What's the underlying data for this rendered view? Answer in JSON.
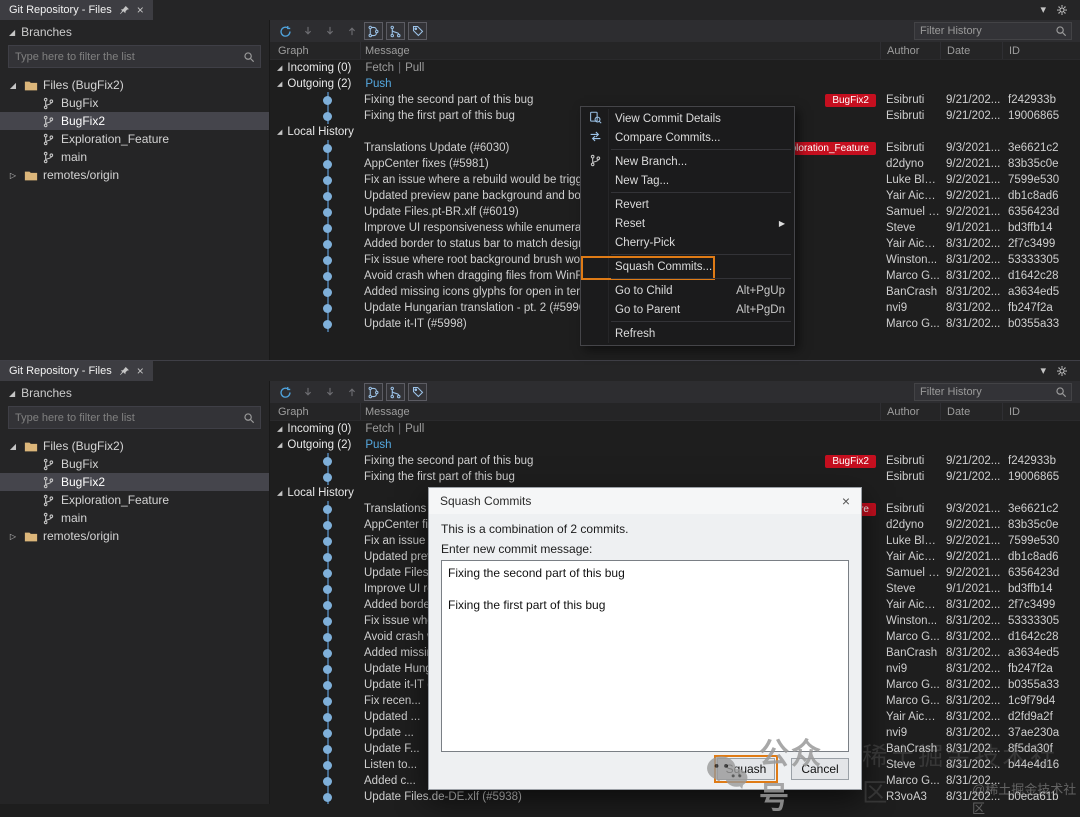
{
  "window": {
    "tab_title": "Git Repository - Files"
  },
  "colors": {
    "annotation_orange": "#df7b16",
    "tag_red": "#c50f1f",
    "link_blue": "#55a9e0",
    "graph_dot_blue": "#7fb0da",
    "selection_gray": "#45454c"
  },
  "sidebar": {
    "header": "Branches",
    "filter_placeholder": "Type here to filter the list",
    "tree": [
      {
        "label": "Files (BugFix2)",
        "level": 0,
        "icon": "folder",
        "expander": "expanded"
      },
      {
        "label": "BugFix",
        "level": 1,
        "icon": "branch"
      },
      {
        "label": "BugFix2",
        "level": 1,
        "icon": "branch",
        "selected": true
      },
      {
        "label": "Exploration_Feature",
        "level": 1,
        "icon": "branch"
      },
      {
        "label": "main",
        "level": 1,
        "icon": "branch"
      },
      {
        "label": "remotes/origin",
        "level": 0,
        "icon": "folder",
        "expander": "collapsed"
      }
    ]
  },
  "history": {
    "toolbar_icons": [
      "refresh",
      "fetch",
      "pull",
      "push",
      "show-graph",
      "show-merges",
      "show-tags"
    ],
    "filter_placeholder": "Filter History",
    "columns": [
      "Graph",
      "Message",
      "Author",
      "Date",
      "ID"
    ]
  },
  "rows_top": [
    {
      "type": "section",
      "label": "Incoming (0)",
      "links": [
        "Fetch",
        "Pull"
      ],
      "links_disabled": true
    },
    {
      "type": "section",
      "label": "Outgoing (2)",
      "links": [
        "Push"
      ],
      "links_disabled": false
    },
    {
      "type": "commit",
      "message": "Fixing the second part of this bug",
      "tag": "BugFix2",
      "author": "Esibruti",
      "date": "9/21/202...",
      "id": "f242933b"
    },
    {
      "type": "commit",
      "message": "Fixing the first part of this bug",
      "author": "Esibruti",
      "date": "9/21/202...",
      "id": "19006865"
    },
    {
      "type": "section",
      "label": "Local History"
    },
    {
      "type": "commit",
      "message": "Translations Update (#6030)",
      "tag": "Exploration_Feature",
      "author": "Esibruti",
      "date": "9/3/2021...",
      "id": "3e6621c2"
    },
    {
      "type": "commit",
      "message": "AppCenter fixes (#5981)",
      "author": "d2dyno",
      "date": "9/2/2021...",
      "id": "83b35c0e"
    },
    {
      "type": "commit",
      "message": "Fix an issue where a rebuild would be triggered o...",
      "author": "Luke Ble...",
      "date": "9/2/2021...",
      "id": "7599e530"
    },
    {
      "type": "commit",
      "message": "Updated preview pane background and border (#...",
      "author": "Yair Aich...",
      "date": "9/2/2021...",
      "id": "db1c8ad6"
    },
    {
      "type": "commit",
      "message": "Update Files.pt-BR.xlf (#6019)",
      "author": "Samuel R...",
      "date": "9/2/2021...",
      "id": "6356423d"
    },
    {
      "type": "commit",
      "message": "Improve UI responsiveness while enumerating (#...",
      "author": "Steve",
      "date": "9/1/2021...",
      "id": "bd3ffb14"
    },
    {
      "type": "commit",
      "message": "Added border to status bar to match design spec...",
      "author": "Yair Aich...",
      "date": "8/31/202...",
      "id": "2f7c3499"
    },
    {
      "type": "commit",
      "message": "Fix issue where root background brush wouldn't ...",
      "author": "Winston...",
      "date": "8/31/202...",
      "id": "53333305"
    },
    {
      "type": "commit",
      "message": "Avoid crash when dragging files from WinRAR (#...",
      "author": "Marco G...",
      "date": "8/31/202...",
      "id": "d1642c28"
    },
    {
      "type": "commit",
      "message": "Added missing icons glyphs for open in terminal ...",
      "author": "BanCrash",
      "date": "8/31/202...",
      "id": "a3634ed5"
    },
    {
      "type": "commit",
      "message": "Update Hungarian translation - pt. 2 (#5996)",
      "author": "nvi9",
      "date": "8/31/202...",
      "id": "fb247f2a"
    },
    {
      "type": "commit",
      "message": "Update it-IT (#5998)",
      "author": "Marco G...",
      "date": "8/31/202...",
      "id": "b0355a33"
    }
  ],
  "rows_bottom": [
    {
      "type": "section",
      "label": "Incoming (0)",
      "links": [
        "Fetch",
        "Pull"
      ],
      "links_disabled": true
    },
    {
      "type": "section",
      "label": "Outgoing (2)",
      "links": [
        "Push"
      ],
      "links_disabled": false
    },
    {
      "type": "commit",
      "message": "Fixing the second part of this bug",
      "tag": "BugFix2",
      "author": "Esibruti",
      "date": "9/21/202...",
      "id": "f242933b"
    },
    {
      "type": "commit",
      "message": "Fixing the first part of this bug",
      "author": "Esibruti",
      "date": "9/21/202...",
      "id": "19006865"
    },
    {
      "type": "section",
      "label": "Local History"
    },
    {
      "type": "commit",
      "message": "Translations Update (#6030)",
      "tag": "Exploration_Feature",
      "author": "Esibruti",
      "date": "9/3/2021...",
      "id": "3e6621c2"
    },
    {
      "type": "commit",
      "message": "AppCenter fixes (#5981)",
      "author": "d2dyno",
      "date": "9/2/2021...",
      "id": "83b35c0e"
    },
    {
      "type": "commit",
      "message": "Fix an issue where a rebuild would be triggered o...",
      "author": "Luke Ble...",
      "date": "9/2/2021...",
      "id": "7599e530"
    },
    {
      "type": "commit",
      "message": "Updated preview pane background and border (#...",
      "author": "Yair Aich...",
      "date": "9/2/2021...",
      "id": "db1c8ad6"
    },
    {
      "type": "commit",
      "message": "Update Files.pt-BR.xlf (#6019)",
      "author": "Samuel R...",
      "date": "9/2/2021...",
      "id": "6356423d"
    },
    {
      "type": "commit",
      "message": "Improve UI responsiveness while enumerating (#...",
      "author": "Steve",
      "date": "9/1/2021...",
      "id": "bd3ffb14"
    },
    {
      "type": "commit",
      "message": "Added border to status bar to match design spec...",
      "author": "Yair Aich...",
      "date": "8/31/202...",
      "id": "2f7c3499"
    },
    {
      "type": "commit",
      "message": "Fix issue where root background brush wouldn't ...",
      "author": "Winston...",
      "date": "8/31/202...",
      "id": "53333305"
    },
    {
      "type": "commit",
      "message": "Avoid crash when dragging files from WinRAR (#...",
      "author": "Marco G...",
      "date": "8/31/202...",
      "id": "d1642c28"
    },
    {
      "type": "commit",
      "message": "Added missing icons glyphs for open in terminal ...",
      "author": "BanCrash",
      "date": "8/31/202...",
      "id": "a3634ed5"
    },
    {
      "type": "commit",
      "message": "Update Hungarian translation - pt. 2 (#5996)",
      "author": "nvi9",
      "date": "8/31/202...",
      "id": "fb247f2a"
    },
    {
      "type": "commit",
      "message": "Update it-IT (#5998)",
      "author": "Marco G...",
      "date": "8/31/202...",
      "id": "b0355a33"
    },
    {
      "type": "commit",
      "message": "Fix recen...",
      "author": "Marco G...",
      "date": "8/31/202...",
      "id": "1c9f79d4"
    },
    {
      "type": "commit",
      "message": "Updated ...",
      "author": "Yair Aich...",
      "date": "8/31/202...",
      "id": "d2fd9a2f"
    },
    {
      "type": "commit",
      "message": "Update ...",
      "author": "nvi9",
      "date": "8/31/202...",
      "id": "37ae230a"
    },
    {
      "type": "commit",
      "message": "Update F...",
      "author": "BanCrash",
      "date": "8/31/202...",
      "id": "8f5da30f"
    },
    {
      "type": "commit",
      "message": "Listen to...",
      "author": "Steve",
      "date": "8/31/202...",
      "id": "b44e4d16"
    },
    {
      "type": "commit",
      "message": "Added c...",
      "author": "Marco G...",
      "date": "8/31/202...",
      "id": ""
    },
    {
      "type": "commit",
      "message": "Update Files.de-DE.xlf (#5938)",
      "author": "R3voA3",
      "date": "8/31/202...",
      "id": "b0eca61b"
    }
  ],
  "context_menu": {
    "items": [
      {
        "label": "View Commit Details",
        "icon": "commit-details"
      },
      {
        "label": "Compare Commits...",
        "icon": "compare"
      },
      {
        "separator": true
      },
      {
        "label": "New Branch...",
        "icon": "branch"
      },
      {
        "label": "New Tag..."
      },
      {
        "separator": true
      },
      {
        "label": "Revert"
      },
      {
        "label": "Reset",
        "submenu": true
      },
      {
        "label": "Cherry-Pick"
      },
      {
        "separator": true
      },
      {
        "label": "Squash Commits...",
        "annotated": true
      },
      {
        "separator": true
      },
      {
        "label": "Go to Child",
        "shortcut": "Alt+PgUp"
      },
      {
        "label": "Go to Parent",
        "shortcut": "Alt+PgDn"
      },
      {
        "separator": true
      },
      {
        "label": "Refresh"
      }
    ]
  },
  "dialog": {
    "title": "Squash Commits",
    "description": "This is a combination of 2 commits.",
    "message_label": "Enter new commit message:",
    "message_value": "Fixing the second part of this bug\n\nFixing the first part of this bug",
    "squash_label": "Squash",
    "cancel_label": "Cancel"
  },
  "watermark": {
    "badge": "公众号",
    "ghost": "稀土掘金技术社区",
    "corner": "@稀土掘金技术社区"
  }
}
